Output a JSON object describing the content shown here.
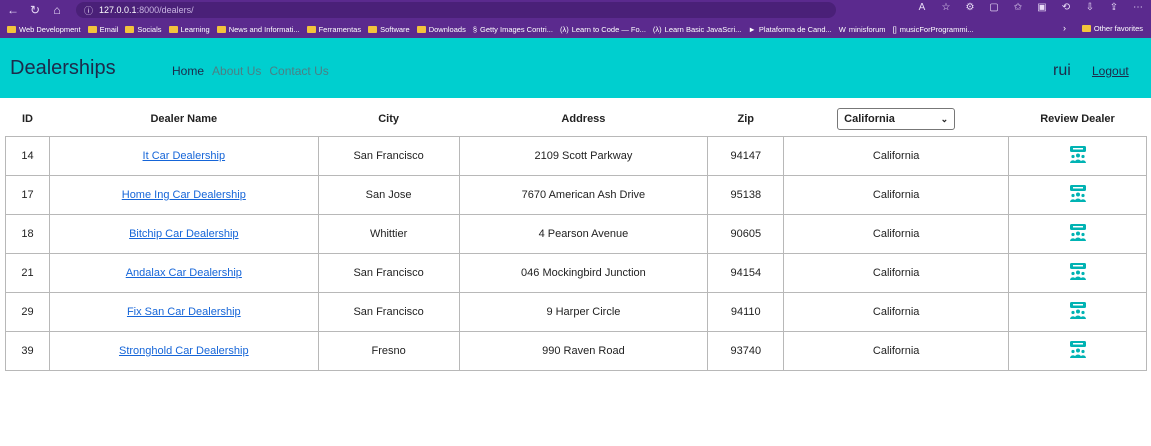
{
  "browser": {
    "url_host": "127.0.0.1",
    "url_path": ":8000/dealers/",
    "bookmarks": [
      "Web Development",
      "Email",
      "Socials",
      "Learning",
      "News and Informati...",
      "Ferramentas",
      "Software",
      "Downloads",
      "Getty Images Contri...",
      "Learn to Code — Fo...",
      "Learn Basic JavaScri...",
      "Plataforma de Cand...",
      "minisforum",
      "musicForProgrammi..."
    ],
    "other_favorites": "Other favorites"
  },
  "navbar": {
    "brand": "Dealerships",
    "links": [
      "Home",
      "About Us",
      "Contact Us"
    ],
    "username": "rui",
    "logout": "Logout"
  },
  "table": {
    "headers": {
      "id": "ID",
      "name": "Dealer Name",
      "city": "City",
      "address": "Address",
      "zip": "Zip",
      "review": "Review Dealer"
    },
    "state_filter": "California",
    "rows": [
      {
        "id": "14",
        "name": "It Car Dealership",
        "city": "San Francisco",
        "address": "2109 Scott Parkway",
        "zip": "94147",
        "state": "California"
      },
      {
        "id": "17",
        "name": "Home Ing Car Dealership",
        "city": "San Jose",
        "address": "7670 American Ash Drive",
        "zip": "95138",
        "state": "California"
      },
      {
        "id": "18",
        "name": "Bitchip Car Dealership",
        "city": "Whittier",
        "address": "4 Pearson Avenue",
        "zip": "90605",
        "state": "California"
      },
      {
        "id": "21",
        "name": "Andalax Car Dealership",
        "city": "San Francisco",
        "address": "046 Mockingbird Junction",
        "zip": "94154",
        "state": "California"
      },
      {
        "id": "29",
        "name": "Fix San Car Dealership",
        "city": "San Francisco",
        "address": "9 Harper Circle",
        "zip": "94110",
        "state": "California"
      },
      {
        "id": "39",
        "name": "Stronghold Car Dealership",
        "city": "Fresno",
        "address": "990 Raven Road",
        "zip": "93740",
        "state": "California"
      }
    ]
  },
  "colors": {
    "navbar": "#00cfcf",
    "link": "#1565d8",
    "review_icon": "#00b3b3"
  }
}
